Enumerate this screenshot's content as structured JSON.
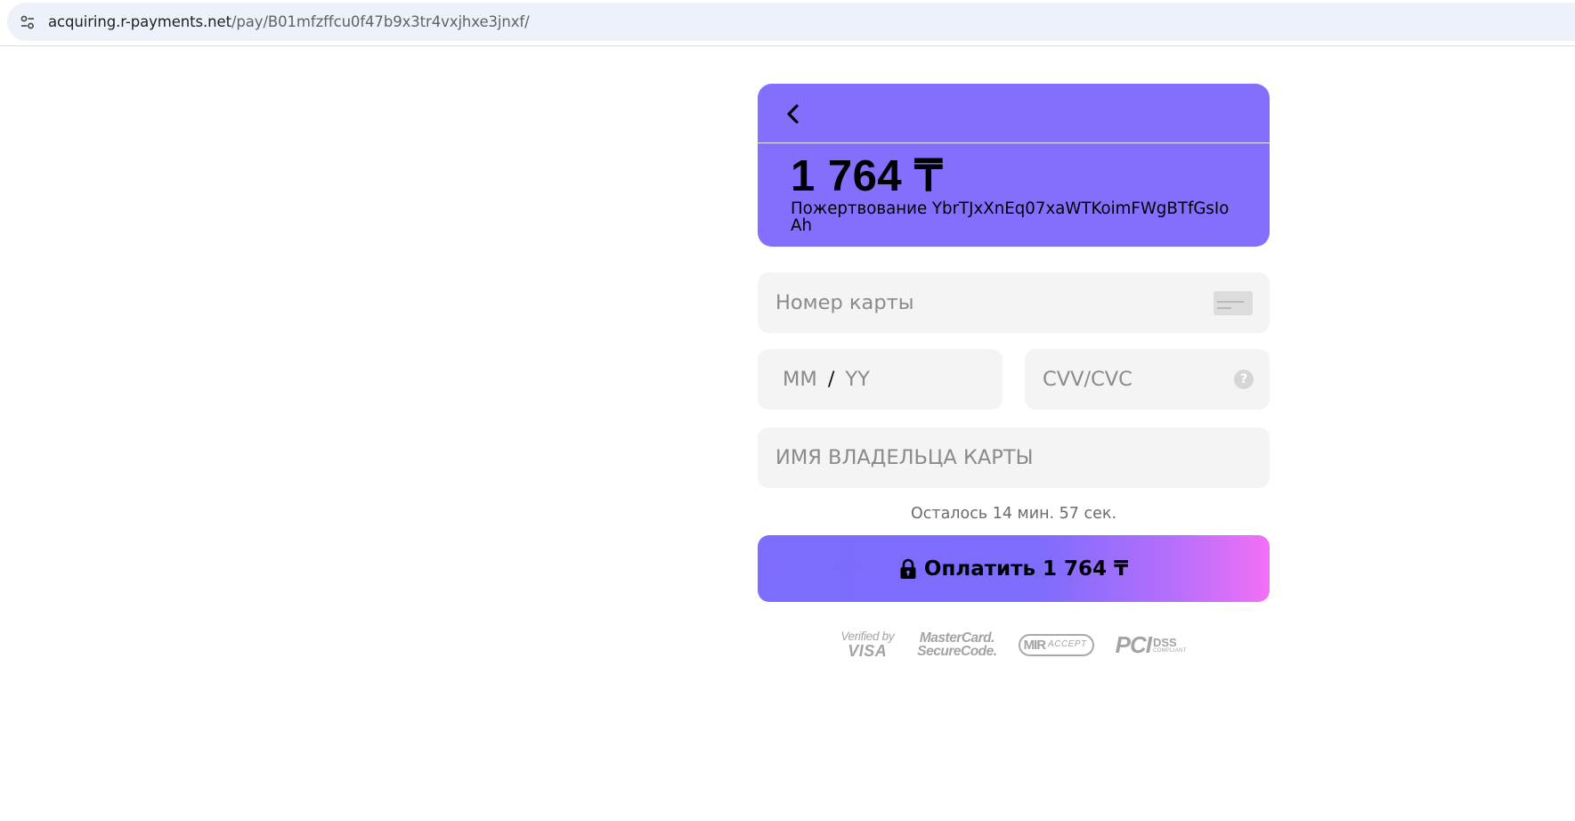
{
  "browser": {
    "url_host": "acquiring.r-payments.net",
    "url_path": "/pay/B01mfzffcu0f47b9x3tr4vxjhxe3jnxf/"
  },
  "payment": {
    "amount": "1 764 ₸",
    "description": "Пожертвование YbrTJxXnEq07xaWTKoimFWgBTfGsIoAh"
  },
  "form": {
    "card_number_placeholder": "Номер карты",
    "expiry_month_placeholder": "MM",
    "expiry_separator": "/",
    "expiry_year_placeholder": "YY",
    "cvv_placeholder": "CVV/CVC",
    "cvv_help": "?",
    "holder_name_placeholder": "ИМЯ ВЛАДЕЛЬЦА КАРТЫ"
  },
  "timer_text": "Осталось 14 мин. 57 сек.",
  "pay_button_label": "Оплатить 1 764 ₸",
  "badges": {
    "visa_top": "Verified by",
    "visa_bottom": "VISA",
    "mc_top": "MasterCard.",
    "mc_bottom": "SecureCode.",
    "mir_main": "MIR",
    "mir_sub": "ACCEPT",
    "pci_main": "PCI",
    "pci_dss": "DSS",
    "pci_compliant": "COMPLIANT"
  },
  "colors": {
    "accent": "#836ffe",
    "button_gradient_start": "#7c6dfd",
    "button_gradient_end": "#f36ff6",
    "field_bg": "#f4f4f4"
  },
  "icons": {
    "site_info": "tune-icon",
    "back": "chevron-left-icon",
    "card": "card-icon",
    "help": "help-circle-icon",
    "lock": "lock-icon"
  }
}
